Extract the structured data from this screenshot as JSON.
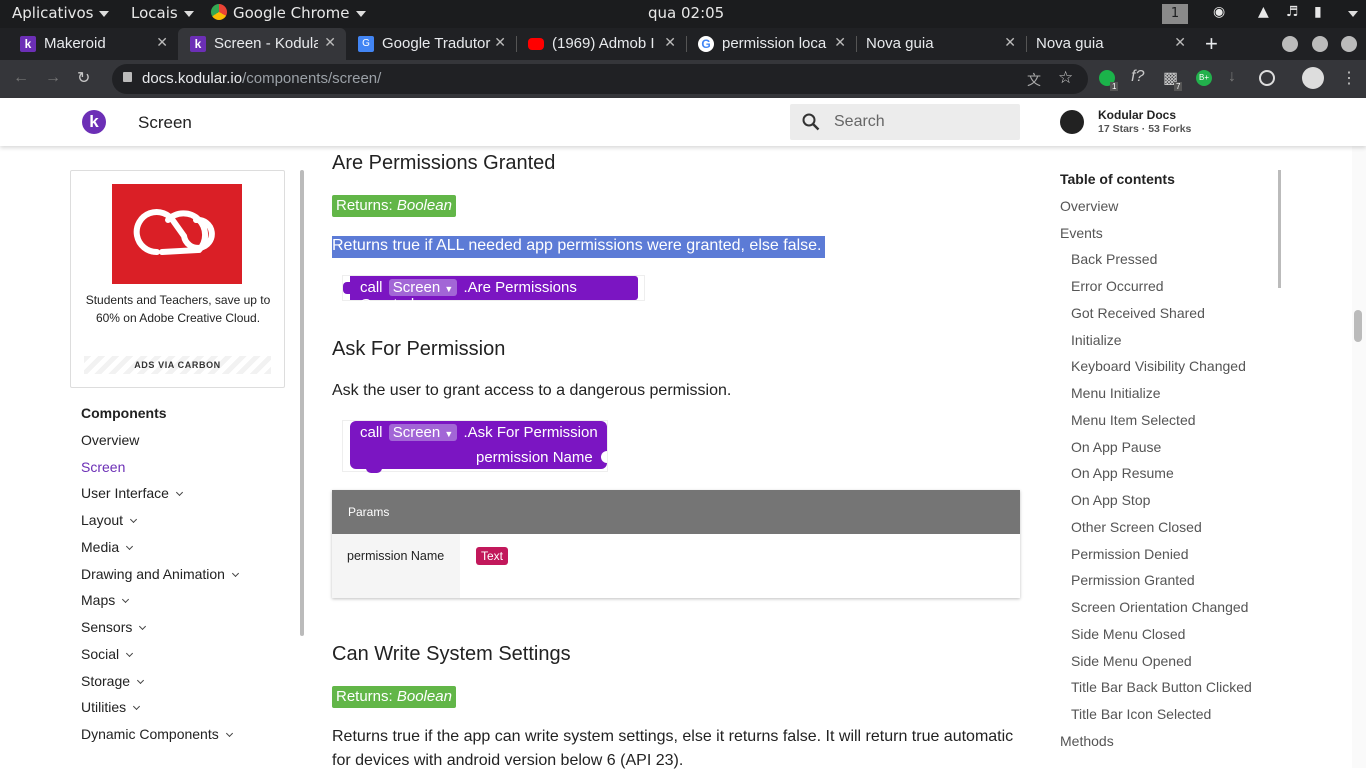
{
  "os_bar": {
    "apps": "Aplicativos",
    "places": "Locais",
    "active_app": "Google Chrome",
    "clock": "qua 02:05",
    "workspace": "1"
  },
  "tabs": [
    {
      "title": "Makeroid",
      "fav_color": "#6c2fb6"
    },
    {
      "title": "Screen - Kodular",
      "fav_color": "#6c2fb6"
    },
    {
      "title": "Google Tradutor",
      "fav_color": "#4285f4"
    },
    {
      "title": "(1969) Admob I",
      "fav_color": "#ff0000"
    },
    {
      "title": "permission loca",
      "fav_color": "#ffffff"
    },
    {
      "title": "Nova guia",
      "fav_color": ""
    },
    {
      "title": "Nova guia",
      "fav_color": ""
    }
  ],
  "url": {
    "host": "docs.kodular.io",
    "path": "/components/screen/"
  },
  "extension_badges": {
    "ext1": "1",
    "ext2": "7"
  },
  "header": {
    "logo": "k",
    "title": "Screen",
    "search_placeholder": "Search",
    "repo_name": "Kodular Docs",
    "repo_stats": "17 Stars · 53 Forks"
  },
  "ad": {
    "text": "Students and Teachers, save up to 60% on Adobe Creative Cloud.",
    "footer": "ADS VIA CARBON"
  },
  "nav": {
    "heading": "Components",
    "items": [
      {
        "label": "Overview"
      },
      {
        "label": "Screen"
      },
      {
        "label": "User Interface"
      },
      {
        "label": "Layout"
      },
      {
        "label": "Media"
      },
      {
        "label": "Drawing and Animation"
      },
      {
        "label": "Maps"
      },
      {
        "label": "Sensors"
      },
      {
        "label": "Social"
      },
      {
        "label": "Storage"
      },
      {
        "label": "Utilities"
      },
      {
        "label": "Dynamic Components"
      }
    ]
  },
  "content": {
    "sec1": {
      "title": "Are Permissions Granted",
      "returns_prefix": "Returns: ",
      "returns_type": "Boolean",
      "desc": "Returns true if ALL needed app permissions were granted, else false.",
      "block_call": "call",
      "block_component": "Screen",
      "block_method": ".Are Permissions Granted"
    },
    "sec2": {
      "title": "Ask For Permission",
      "desc": "Ask the user to grant access to a dangerous permission.",
      "block_call": "call",
      "block_component": "Screen",
      "block_method": ".Ask For Permission",
      "block_param": "permission Name",
      "params_header": "Params",
      "param_name": "permission Name",
      "param_type": "Text"
    },
    "sec3": {
      "title": "Can Write System Settings",
      "returns_prefix": "Returns: ",
      "returns_type": "Boolean",
      "desc_line1": "Returns true if the app can write system settings, else it returns false. It will return true automatic",
      "desc_line2": "for devices with android version below 6 (API 23)."
    }
  },
  "toc": {
    "heading": "Table of contents",
    "items": [
      {
        "label": "Overview"
      },
      {
        "label": "Events"
      },
      {
        "label": "Back Pressed"
      },
      {
        "label": "Error Occurred"
      },
      {
        "label": "Got Received Shared"
      },
      {
        "label": "Initialize"
      },
      {
        "label": "Keyboard Visibility Changed"
      },
      {
        "label": "Menu Initialize"
      },
      {
        "label": "Menu Item Selected"
      },
      {
        "label": "On App Pause"
      },
      {
        "label": "On App Resume"
      },
      {
        "label": "On App Stop"
      },
      {
        "label": "Other Screen Closed"
      },
      {
        "label": "Permission Denied"
      },
      {
        "label": "Permission Granted"
      },
      {
        "label": "Screen Orientation Changed"
      },
      {
        "label": "Side Menu Closed"
      },
      {
        "label": "Side Menu Opened"
      },
      {
        "label": "Title Bar Back Button Clicked"
      },
      {
        "label": "Title Bar Icon Selected"
      },
      {
        "label": "Methods"
      }
    ]
  },
  "colors": {
    "accent": "#6c2fb6",
    "returns_green": "#62b648",
    "block_purple": "#7b15c2",
    "selection": "#5c7bd6",
    "text_badge": "#c2185b"
  }
}
